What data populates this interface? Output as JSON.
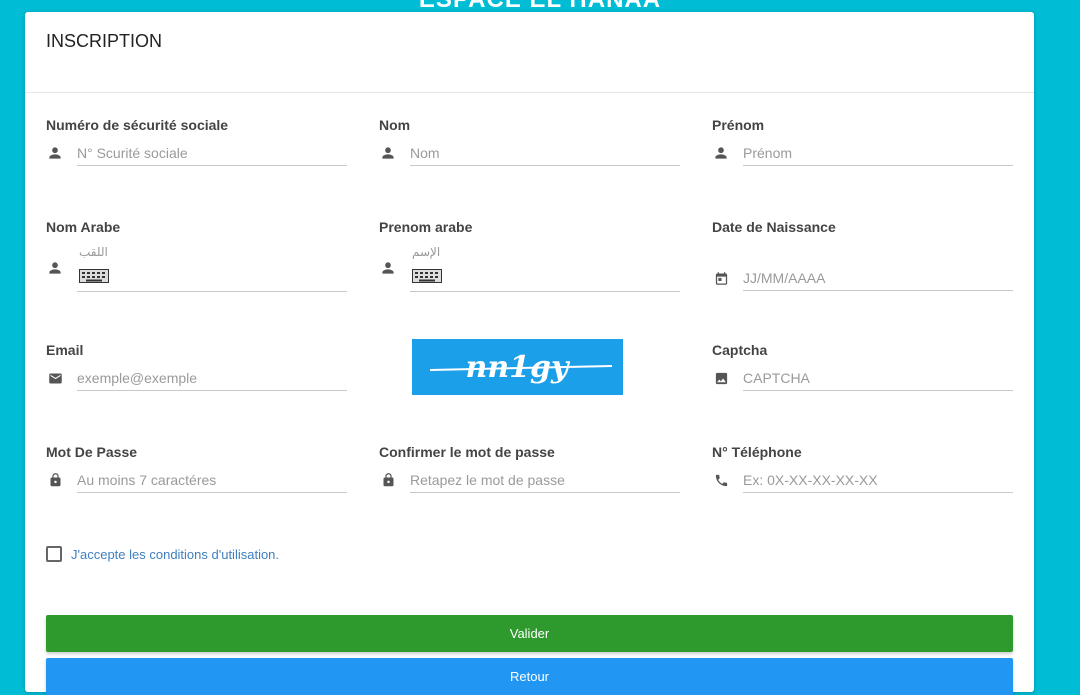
{
  "banner": "ESPACE EL HANAA",
  "form": {
    "title": "INSCRIPTION",
    "fields": {
      "secu": {
        "label": "Numéro de sécurité sociale",
        "placeholder": "N° Scurité sociale"
      },
      "nom": {
        "label": "Nom",
        "placeholder": "Nom"
      },
      "prenom": {
        "label": "Prénom",
        "placeholder": "Prénom"
      },
      "nom_arabe": {
        "label": "Nom Arabe",
        "placeholder": "اللقب"
      },
      "prenom_arabe": {
        "label": "Prenom arabe",
        "placeholder": "الإسم"
      },
      "naissance": {
        "label": "Date de Naissance",
        "placeholder": "JJ/MM/AAAA"
      },
      "email": {
        "label": "Email",
        "placeholder": "exemple@exemple"
      },
      "captcha": {
        "label": "Captcha",
        "placeholder": "CAPTCHA",
        "image_text": "nn1gy"
      },
      "password": {
        "label": "Mot De Passe",
        "placeholder": "Au moins 7 caractéres"
      },
      "confirm": {
        "label": "Confirmer le mot de passe",
        "placeholder": "Retapez le mot de passe"
      },
      "phone": {
        "label": "N° Téléphone",
        "placeholder": "Ex: 0X-XX-XX-XX-XX"
      }
    },
    "terms": "J'accepte les conditions d'utilisation.",
    "submit_label": "Valider",
    "back_label": "Retour"
  },
  "colors": {
    "background": "#00bcd4",
    "submit": "#2e9a2e",
    "back": "#2196f3",
    "link": "#3f7fbf"
  }
}
